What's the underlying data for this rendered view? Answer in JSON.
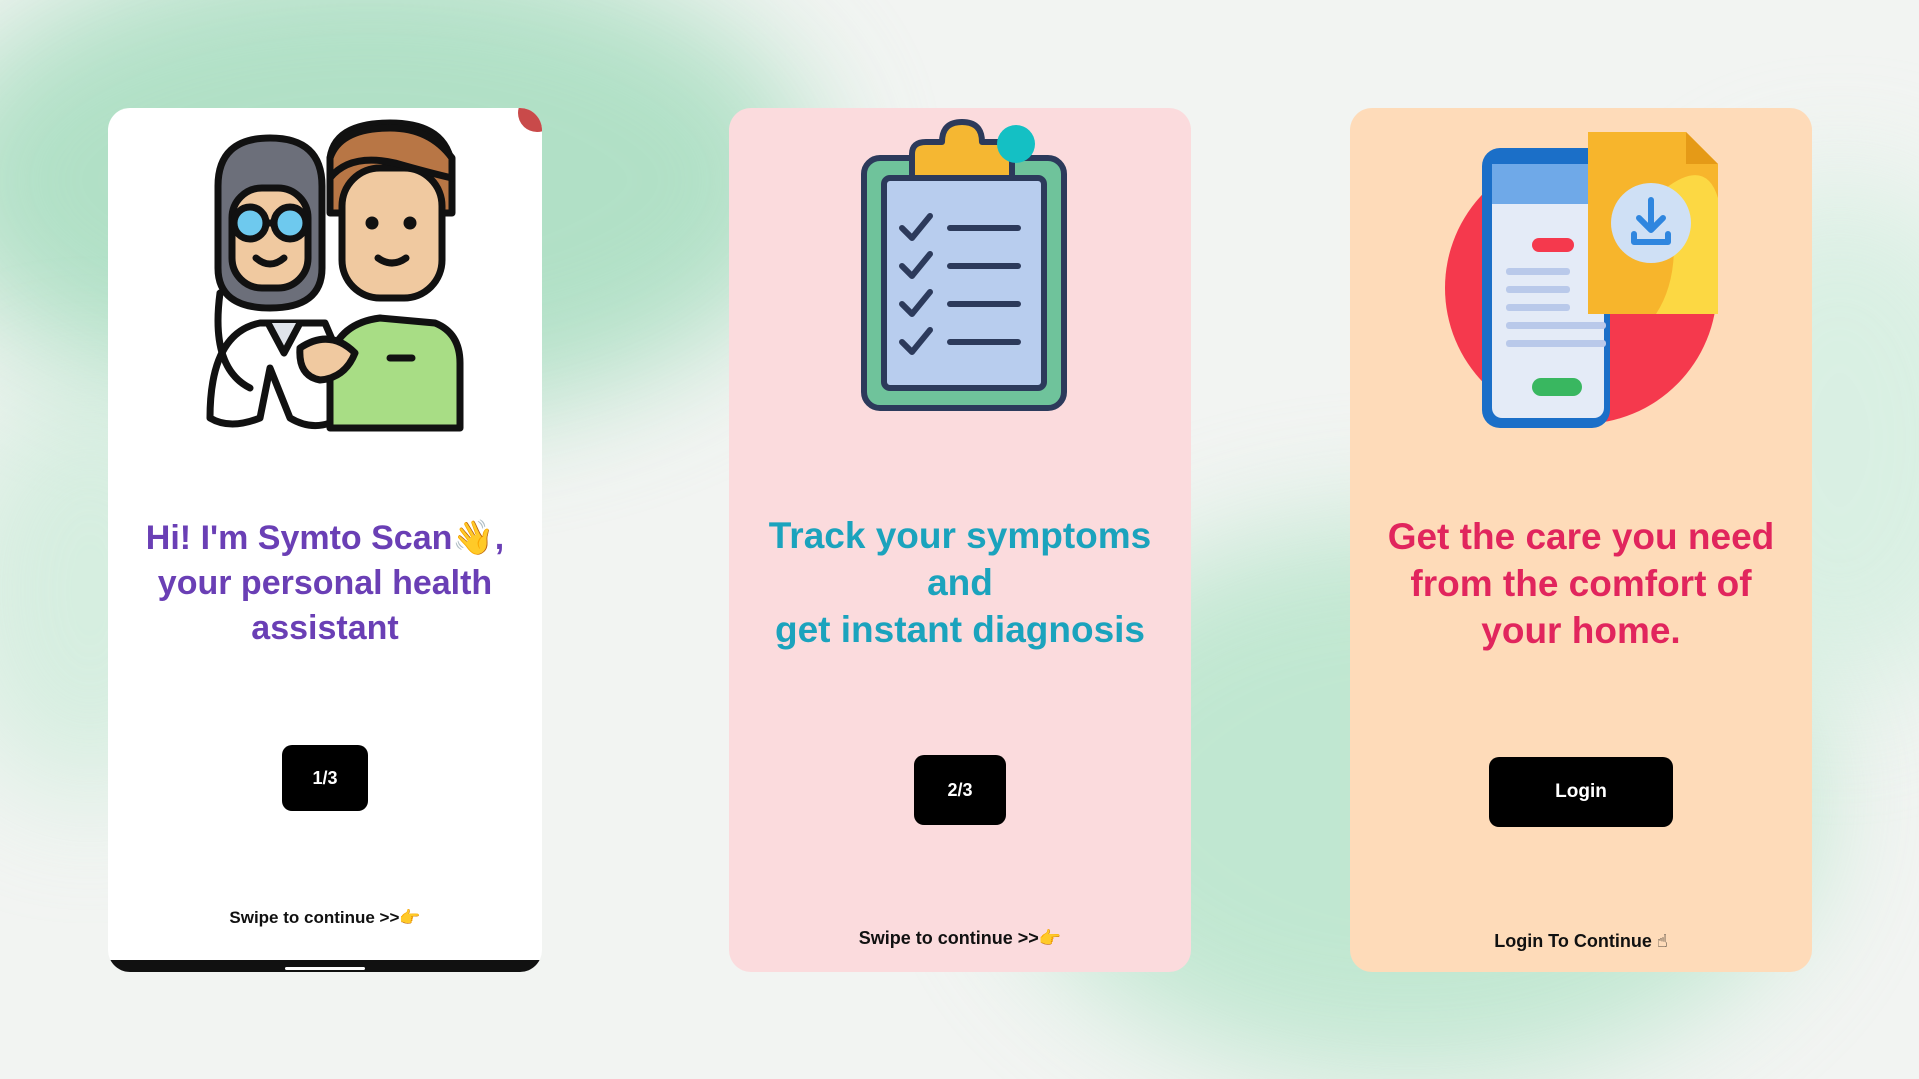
{
  "cards": [
    {
      "headline": "Hi! I'm Symto Scan👋, your personal health assistant",
      "button": "1/3",
      "hint": "Swipe to continue  >>👉",
      "illustration": "doctor-and-patient-icon"
    },
    {
      "headline_lines": [
        "Track your symptoms",
        "and",
        "get instant diagnosis"
      ],
      "button": "2/3",
      "hint": "Swipe to continue  >>👉",
      "illustration": "clipboard-checklist-icon"
    },
    {
      "headline_lines": [
        "Get the care you need",
        "from the comfort of",
        "your home."
      ],
      "button": "Login",
      "hint": "Login To Continue ☝",
      "illustration": "phone-download-icon"
    }
  ],
  "colors": {
    "card1_bg": "#ffffff",
    "card2_bg": "#fbdbdd",
    "card3_bg": "#fedbb9",
    "headline1": "#6a3fb5",
    "headline2": "#1ba3bd",
    "headline3": "#e1255d",
    "button_bg": "#000000"
  }
}
